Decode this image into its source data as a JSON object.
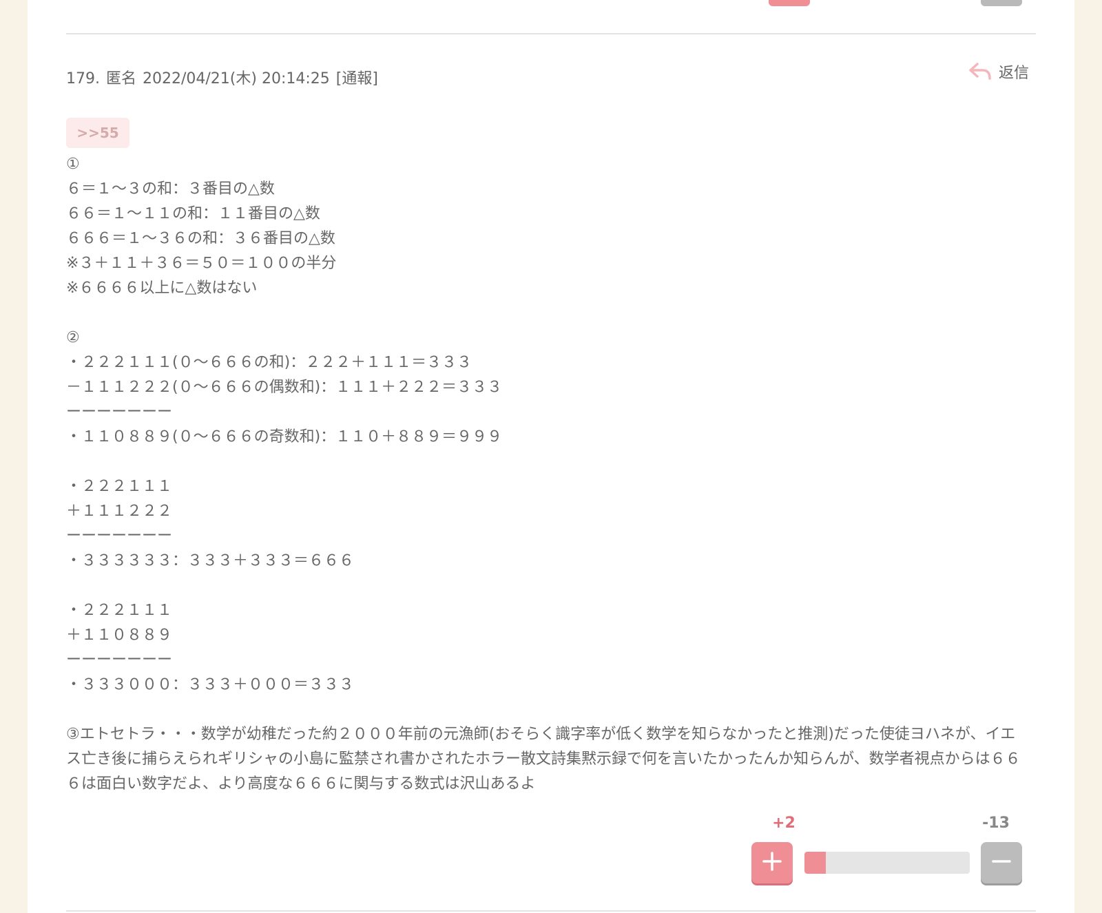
{
  "comment": {
    "number": "179.",
    "author": "匿名",
    "datetime": "2022/04/21(木) 20:14:25",
    "report_label": "[通報]",
    "reply_label": "返信",
    "anchor": ">>55",
    "body_lines": [
      "①",
      "６＝１～３の和：３番目の△数",
      "６６＝１～１１の和：１１番目の△数",
      "６６６＝１～３６の和：３６番目の△数",
      "※３＋１１＋３６＝５０＝１００の半分",
      "※６６６６以上に△数はない",
      "",
      "②",
      "・２２２１１１(０～６６６の和)：２２２＋１１１＝３３３",
      "－１１１２２２(０～６６６の偶数和)：１１１＋２２２＝３３３",
      "ーーーーーーー",
      "・１１０８８９(０～６６６の奇数和)：１１０＋８８９＝９９９",
      "",
      "・２２２１１１",
      "＋１１１２２２",
      "ーーーーーーー",
      "・３３３３３３：３３３＋３３３＝６６６",
      "",
      "・２２２１１１",
      "＋１１０８８９",
      "ーーーーーーー",
      "・３３３０００：３３３＋０００＝３３３",
      ""
    ],
    "body_paragraph": "③エトセトラ・・・数学が幼稚だった約２０００年前の元漁師(おそらく識字率が低く数学を知らなかったと推測)だった使徒ヨハネが、イエス亡き後に捕らえられギリシャの小島に監禁され書かされたホラー散文詩集黙示録で何を言いたかったんか知らんが、数学者視点からは６６６は面白い数字だよ、より高度な６６６に関与する数式は沢山あるよ",
    "votes": {
      "plus_label": "+2",
      "minus_label": "-13",
      "plus_ratio": 0.13
    }
  },
  "colors": {
    "background": "#f8f3e6",
    "plus_accent": "#f08e96",
    "minus_gray": "#bcbcbc",
    "text": "#666666"
  },
  "icons": {
    "reply": "reply-arrow-icon",
    "plus": "plus-icon",
    "minus": "minus-icon"
  }
}
